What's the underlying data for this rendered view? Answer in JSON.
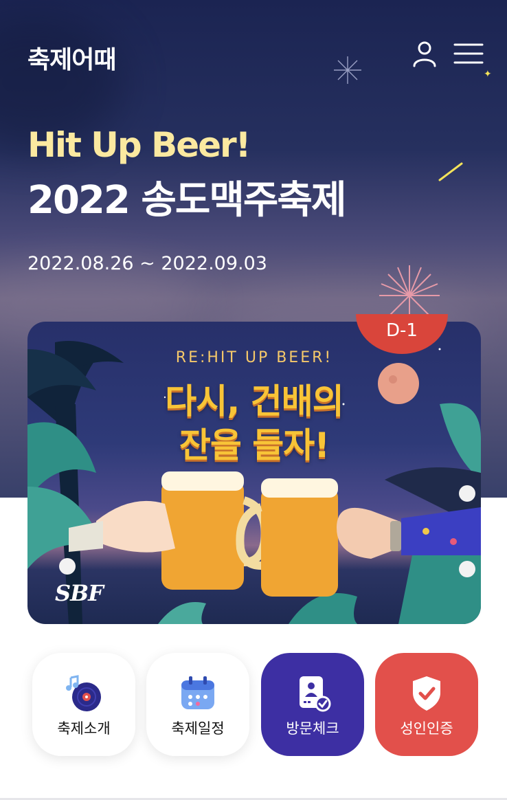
{
  "header": {
    "logo_text": "축제어때",
    "user_icon": "user-icon",
    "menu_icon": "hamburger-menu-icon"
  },
  "hero": {
    "tagline": "Hit Up Beer!",
    "title": "2022 송도맥주축제",
    "dates": "2022.08.26 ~ 2022.09.03"
  },
  "banner": {
    "dday": "D-1",
    "subtitle": "RE:HIT UP BEER!",
    "line1": "다시, 건배의",
    "line2": "잔을 들자!",
    "logo": "SBF"
  },
  "quick_menu": [
    {
      "label": "축제소개",
      "icon": "music-record-icon"
    },
    {
      "label": "축제일정",
      "icon": "calendar-icon"
    },
    {
      "label": "방문체크",
      "icon": "visit-check-badge-icon"
    },
    {
      "label": "성인인증",
      "icon": "shield-check-icon"
    }
  ],
  "colors": {
    "hero_bg": "#1b2452",
    "tagline": "#fbe9a0",
    "dday_badge": "#d9453b",
    "banner_text": "#f8c437",
    "visit_button": "#3d2fa3",
    "adult_button": "#e2504b"
  }
}
